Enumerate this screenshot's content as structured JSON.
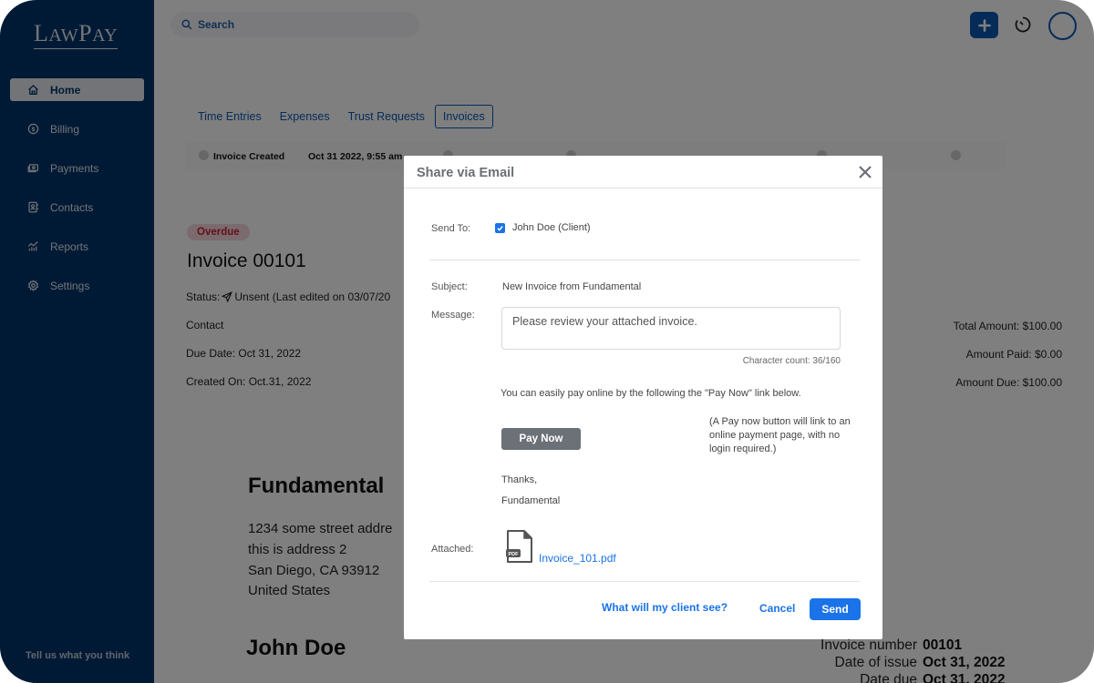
{
  "sidebar": {
    "logo": {
      "first": "L",
      "rest1": "AW",
      "second": "P",
      "rest2": "AY"
    },
    "items": [
      {
        "label": "Home",
        "icon": "home-icon",
        "active": true
      },
      {
        "label": "Billing",
        "icon": "dollar-circle-icon"
      },
      {
        "label": "Payments",
        "icon": "payments-icon"
      },
      {
        "label": "Contacts",
        "icon": "contacts-icon"
      },
      {
        "label": "Reports",
        "icon": "reports-icon"
      },
      {
        "label": "Settings",
        "icon": "gear-icon"
      }
    ],
    "feedback": "Tell us what you think"
  },
  "topbar": {
    "search_placeholder": "Search"
  },
  "tabs": [
    {
      "label": "Time Entries"
    },
    {
      "label": "Expenses"
    },
    {
      "label": "Trust Requests"
    },
    {
      "label": "Invoices",
      "active": true
    }
  ],
  "timeline": {
    "event": "Invoice Created",
    "timestamp": "Oct 31 2022, 9:55 am"
  },
  "invoice": {
    "badge": "Overdue",
    "title": "Invoice 00101",
    "status_label": "Status:",
    "status_value": "Unsent (Last edited on 03/07/20",
    "contact": "Contact",
    "due_date": "Due Date: Oct 31, 2022",
    "created_on": "Created On: Oct.31, 2022",
    "total_amount": "Total Amount: $100.00",
    "amount_paid": "Amount Paid: $0.00",
    "amount_due": "Amount Due: $100.00"
  },
  "document": {
    "company": "Fundamental",
    "address": [
      "1234 some street addre",
      "this is address 2",
      "San Diego, CA 93912",
      "United States"
    ],
    "client": "John Doe",
    "meta": [
      {
        "key": "Invoice number",
        "value": "00101"
      },
      {
        "key": "Date of issue",
        "value": "Oct 31, 2022"
      },
      {
        "key": "Date due",
        "value": "Oct 31, 2022"
      }
    ]
  },
  "modal": {
    "title": "Share via Email",
    "send_to_label": "Send To:",
    "recipient": "John Doe (Client)",
    "recipient_checked": true,
    "subject_label": "Subject:",
    "subject": "New Invoice from Fundamental",
    "message_label": "Message:",
    "message": "Please review your attached invoice.",
    "char_count": "Character count: 36/160",
    "pay_intro": "You can easily pay online by the following the \"Pay Now\" link below.",
    "pay_now": "Pay Now",
    "pay_note": "(A Pay now button will link to an online payment page, with no login required.)",
    "thanks": "Thanks,",
    "signature": "Fundamental",
    "attached_label": "Attached:",
    "file_badge": "PDF",
    "file_name": "Invoice_101.pdf",
    "preview_link": "What will my client see?",
    "cancel": "Cancel",
    "send": "Send"
  },
  "colors": {
    "brand_navy": "#00346b",
    "link_blue": "#1a73e8",
    "overdue_red": "#c62333"
  }
}
